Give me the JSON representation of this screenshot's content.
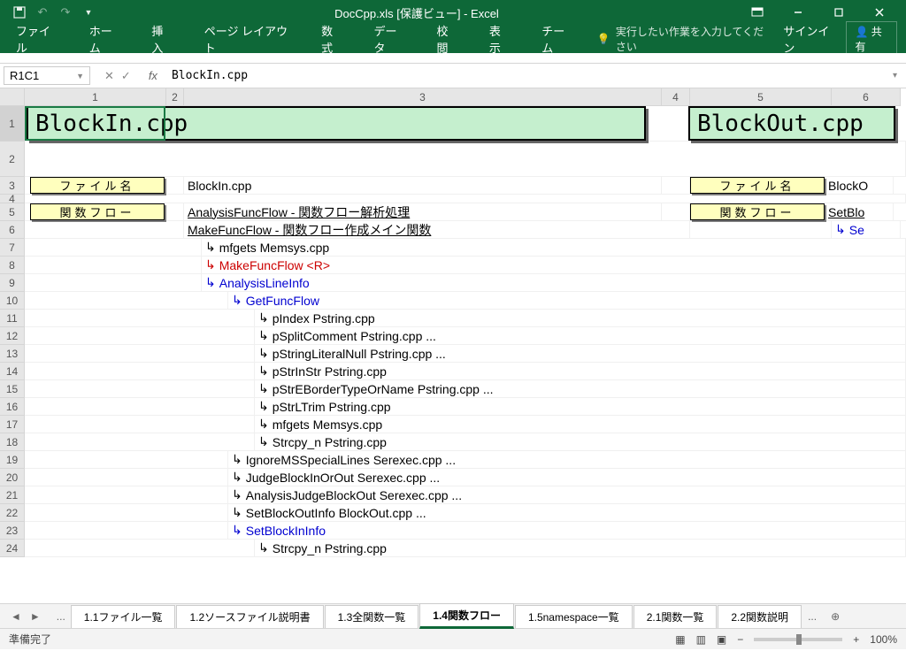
{
  "titlebar": {
    "title": "DocCpp.xls [保護ビュー] - Excel"
  },
  "ribbon": {
    "tabs": [
      "ファイル",
      "ホーム",
      "挿入",
      "ページ レイアウト",
      "数式",
      "データ",
      "校閲",
      "表示",
      "チーム"
    ],
    "tellme": "実行したい作業を入力してください",
    "signin": "サインイン",
    "share": "共有"
  },
  "formula": {
    "namebox": "R1C1",
    "value": "BlockIn.cpp"
  },
  "cols": {
    "c1": 160,
    "c2": 20,
    "c3": 540,
    "c4": 32,
    "c5": 160,
    "c6": 78
  },
  "headers": {
    "h1": "BlockIn.cpp",
    "h2": "BlockOut.cpp"
  },
  "labels": {
    "filename": "ファイル名",
    "funcflow": "関数フロー"
  },
  "content": {
    "file1": "BlockIn.cpp",
    "file2": "BlockO",
    "r5a": "AnalysisFuncFlow - 関数フロー解析処理",
    "r5b": "SetBlo",
    "r6": "MakeFuncFlow - 関数フロー作成メイン関数",
    "r6b": "Se",
    "r7": "mfgets Memsys.cpp",
    "r8": "MakeFuncFlow <R>",
    "r9": "AnalysisLineInfo",
    "r10": "GetFuncFlow",
    "r11": "pIndex Pstring.cpp",
    "r12": "pSplitComment Pstring.cpp ...",
    "r13": "pStringLiteralNull Pstring.cpp ...",
    "r14": "pStrInStr Pstring.cpp",
    "r15": "pStrEBorderTypeOrName Pstring.cpp ...",
    "r16": "pStrLTrim Pstring.cpp",
    "r17": "mfgets Memsys.cpp",
    "r18": "Strcpy_n Pstring.cpp",
    "r19": "IgnoreMSSpecialLines Serexec.cpp ...",
    "r20": "JudgeBlockInOrOut Serexec.cpp ...",
    "r21": "AnalysisJudgeBlockOut Serexec.cpp ...",
    "r22": "SetBlockOutInfo BlockOut.cpp ...",
    "r23": "SetBlockInInfo",
    "r24": "Strcpy_n Pstring.cpp"
  },
  "sheets": [
    "1.1ファイル一覧",
    "1.2ソースファイル説明書",
    "1.3全関数一覧",
    "1.4関数フロー",
    "1.5namespace一覧",
    "2.1関数一覧",
    "2.2関数説明"
  ],
  "status": {
    "ready": "準備完了",
    "zoom": "100%"
  }
}
